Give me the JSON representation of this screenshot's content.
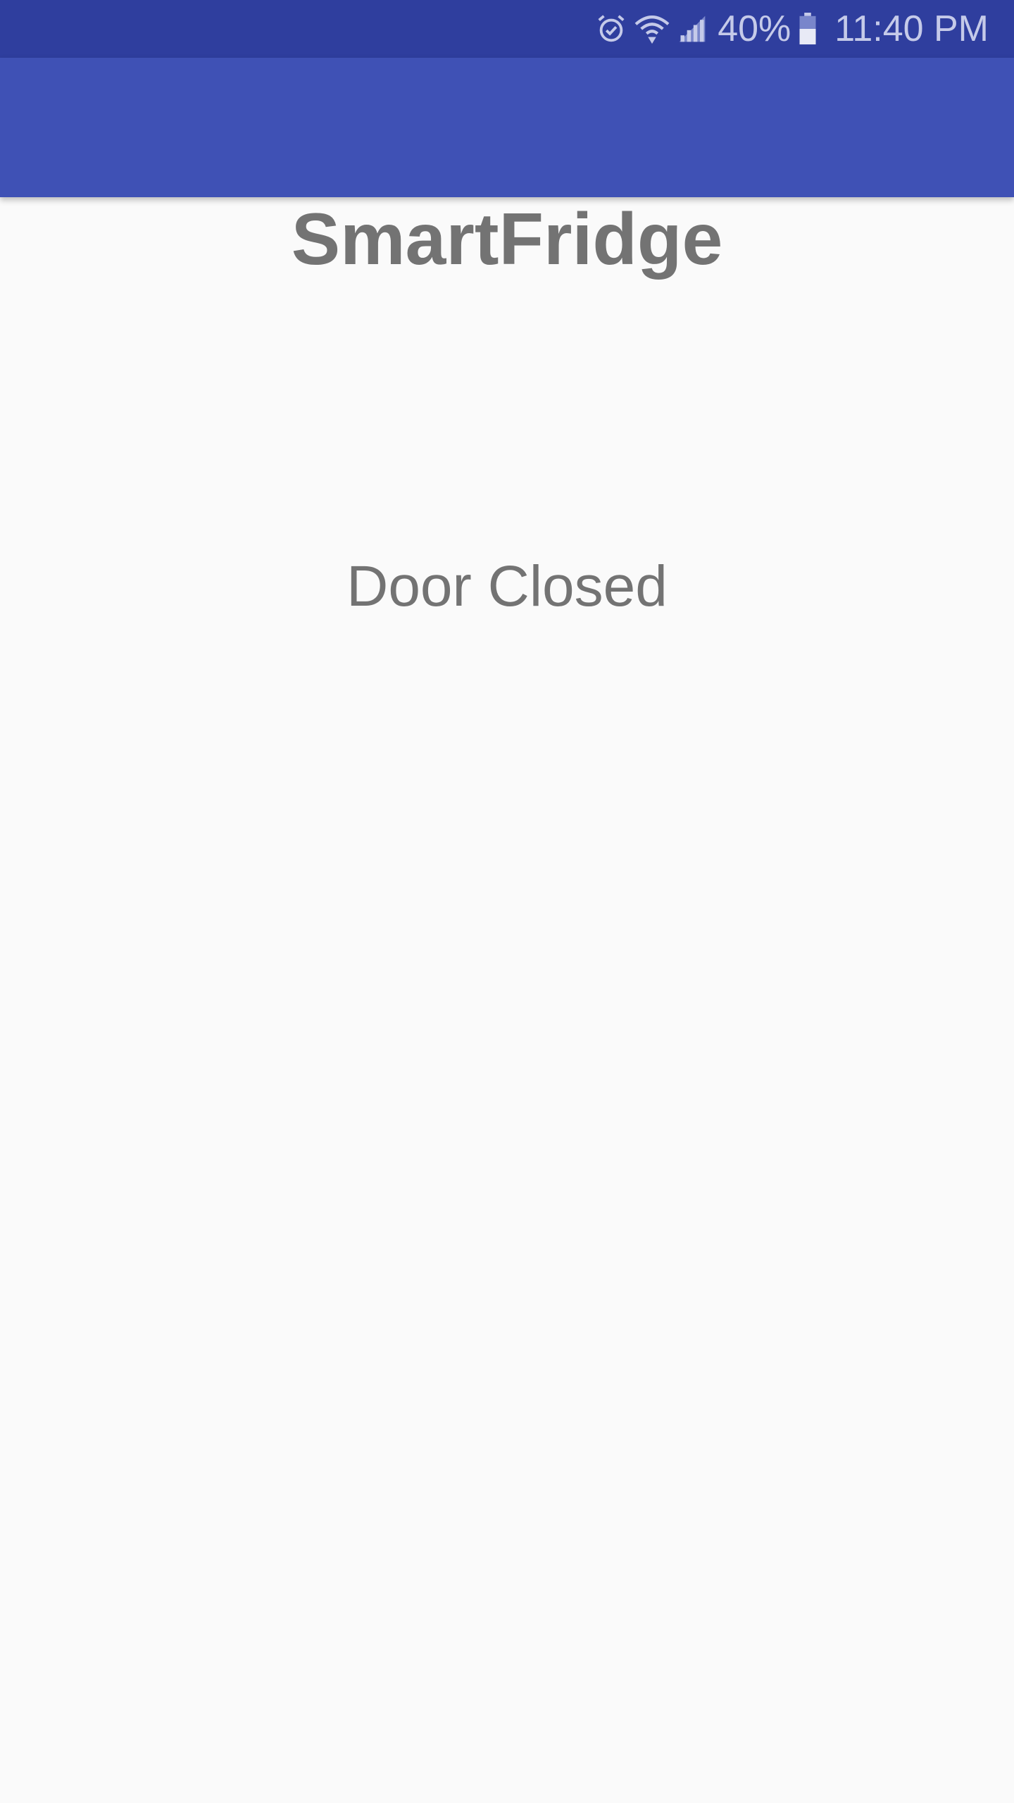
{
  "status_bar": {
    "icons": [
      "alarm-icon",
      "wifi-icon",
      "cell-signal-icon",
      "battery-icon"
    ],
    "battery_percent": "40%",
    "time": "11:40 PM",
    "background_color": "#2f3e9e",
    "foreground_color": "#c5cae9"
  },
  "app_bar": {
    "background_color": "#3f51b5"
  },
  "main": {
    "title": "SmartFridge",
    "door_status": "Door Closed",
    "text_color": "#737373",
    "background_color": "#fafafa"
  }
}
